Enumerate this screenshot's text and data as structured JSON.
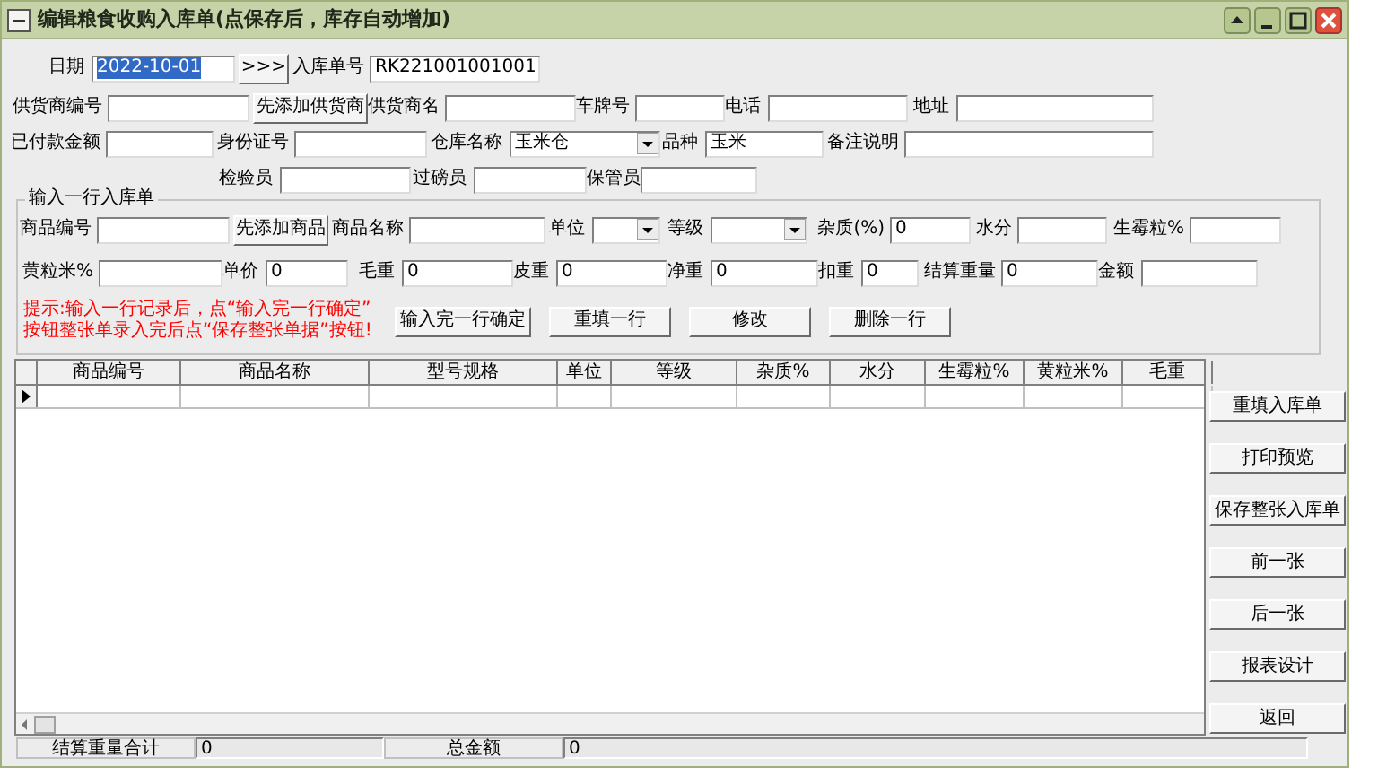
{
  "window": {
    "title": "编辑粮食收购入库单(点保存后，库存自动增加)"
  },
  "header_rows": [
    [
      {
        "kind": "label",
        "text": "日期"
      },
      {
        "kind": "input",
        "value": "2022-10-01",
        "text_selected": true
      },
      {
        "kind": "button",
        "text": ">>>"
      },
      {
        "kind": "label",
        "text": "入库单号"
      },
      {
        "kind": "input",
        "value": "RK221001001001"
      }
    ],
    [
      {
        "kind": "label",
        "text": "供货商编号"
      },
      {
        "kind": "input"
      },
      {
        "kind": "button",
        "text": "先添加供货商"
      },
      {
        "kind": "label",
        "text": "供货商名"
      },
      {
        "kind": "input"
      },
      {
        "kind": "label",
        "text": "车牌号"
      },
      {
        "kind": "input"
      },
      {
        "kind": "label",
        "text": "电话"
      },
      {
        "kind": "input"
      },
      {
        "kind": "label",
        "text": "地址"
      },
      {
        "kind": "input"
      }
    ],
    [
      {
        "kind": "label",
        "text": "已付款金额"
      },
      {
        "kind": "input"
      },
      {
        "kind": "label",
        "text": "身份证号"
      },
      {
        "kind": "input"
      },
      {
        "kind": "label",
        "text": "仓库名称"
      },
      {
        "kind": "select",
        "value": "玉米仓"
      },
      {
        "kind": "label",
        "text": "品种"
      },
      {
        "kind": "input",
        "value": "玉米"
      },
      {
        "kind": "label",
        "text": "备注说明"
      },
      {
        "kind": "input"
      }
    ],
    [
      {
        "kind": "label",
        "text": "检验员"
      },
      {
        "kind": "input"
      },
      {
        "kind": "label",
        "text": "过磅员"
      },
      {
        "kind": "input"
      },
      {
        "kind": "label",
        "text": "保管员"
      },
      {
        "kind": "input"
      }
    ]
  ],
  "entry_group": {
    "title": "输入一行入库单",
    "first_line": [
      {
        "kind": "label",
        "text": "商品编号"
      },
      {
        "kind": "input"
      },
      {
        "kind": "button",
        "text": "先添加商品"
      },
      {
        "kind": "label",
        "text": "商品名称"
      },
      {
        "kind": "input"
      },
      {
        "kind": "label",
        "text": "单位"
      },
      {
        "kind": "select"
      },
      {
        "kind": "label",
        "text": "等级"
      },
      {
        "kind": "select"
      },
      {
        "kind": "label",
        "text": "杂质(%)"
      },
      {
        "kind": "input",
        "value": "0"
      },
      {
        "kind": "label",
        "text": "水分"
      },
      {
        "kind": "input"
      },
      {
        "kind": "label",
        "text": "生霉粒%"
      },
      {
        "kind": "input"
      }
    ],
    "second_line": [
      {
        "kind": "label",
        "text": "黄粒米%"
      },
      {
        "kind": "input"
      },
      {
        "kind": "label",
        "text": "单价"
      },
      {
        "kind": "input",
        "value": "0"
      },
      {
        "kind": "label",
        "text": "毛重"
      },
      {
        "kind": "input",
        "value": "0"
      },
      {
        "kind": "label",
        "text": "皮重"
      },
      {
        "kind": "input",
        "value": "0"
      },
      {
        "kind": "label",
        "text": "净重"
      },
      {
        "kind": "input",
        "value": "0"
      },
      {
        "kind": "label",
        "text": "扣重"
      },
      {
        "kind": "input",
        "value": "0"
      },
      {
        "kind": "label",
        "text": "结算重量"
      },
      {
        "kind": "input",
        "value": "0"
      },
      {
        "kind": "label",
        "text": "金额"
      },
      {
        "kind": "input"
      }
    ],
    "hint_lines": [
      "提示:输入一行记录后，点“输入完一行确定”",
      "按钮整张单录入完后点“保存整张单据”按钮!"
    ],
    "buttons": [
      "输入完一行确定",
      "重填一行",
      "修改",
      "删除一行"
    ]
  },
  "grid": {
    "columns": [
      "商品编号",
      "商品名称",
      "型号规格",
      "单位",
      "等级",
      "杂质%",
      "水分",
      "生霉粒%",
      "黄粒米%",
      "毛重"
    ],
    "rows": [
      {
        "selected": true
      }
    ]
  },
  "side_buttons": [
    "重填入库单",
    "打印预览",
    "保存整张入库单",
    "前一张",
    "后一张",
    "报表设计",
    "返回"
  ],
  "totals": [
    {
      "label": "结算重量合计",
      "value": "0"
    },
    {
      "label": "总金额",
      "value": "0"
    }
  ]
}
